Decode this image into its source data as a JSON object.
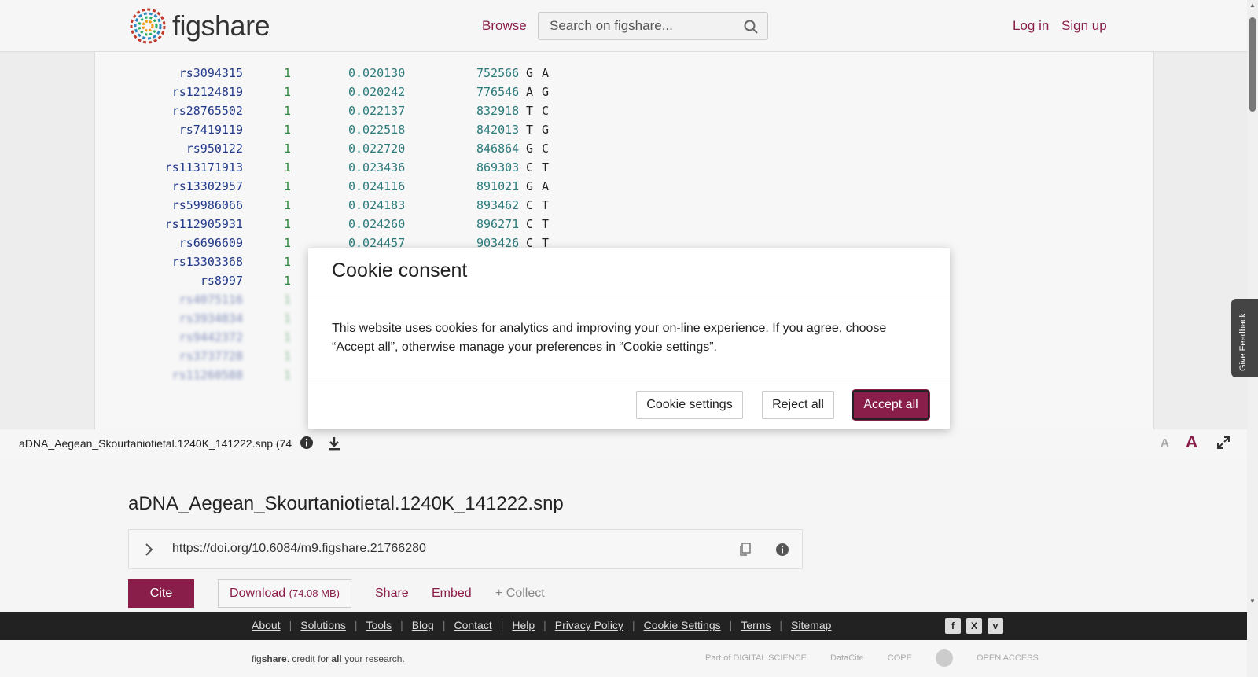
{
  "header": {
    "logo_text": "figshare",
    "browse": "Browse",
    "search_placeholder": "Search on figshare...",
    "login": "Log in",
    "signup": "Sign up"
  },
  "viewer": {
    "rows": [
      {
        "id": "rs3094315",
        "chr": "1",
        "gen": "0.020130",
        "pos": "752566",
        "a1": "G",
        "a2": "A"
      },
      {
        "id": "rs12124819",
        "chr": "1",
        "gen": "0.020242",
        "pos": "776546",
        "a1": "A",
        "a2": "G"
      },
      {
        "id": "rs28765502",
        "chr": "1",
        "gen": "0.022137",
        "pos": "832918",
        "a1": "T",
        "a2": "C"
      },
      {
        "id": "rs7419119",
        "chr": "1",
        "gen": "0.022518",
        "pos": "842013",
        "a1": "T",
        "a2": "G"
      },
      {
        "id": "rs950122",
        "chr": "1",
        "gen": "0.022720",
        "pos": "846864",
        "a1": "G",
        "a2": "C"
      },
      {
        "id": "rs113171913",
        "chr": "1",
        "gen": "0.023436",
        "pos": "869303",
        "a1": "C",
        "a2": "T"
      },
      {
        "id": "rs13302957",
        "chr": "1",
        "gen": "0.024116",
        "pos": "891021",
        "a1": "G",
        "a2": "A"
      },
      {
        "id": "rs59986066",
        "chr": "1",
        "gen": "0.024183",
        "pos": "893462",
        "a1": "C",
        "a2": "T"
      },
      {
        "id": "rs112905931",
        "chr": "1",
        "gen": "0.024260",
        "pos": "896271",
        "a1": "C",
        "a2": "T"
      },
      {
        "id": "rs6696609",
        "chr": "1",
        "gen": "0.024457",
        "pos": "903426",
        "a1": "C",
        "a2": "T"
      },
      {
        "id": "rs13303368",
        "chr": "1",
        "gen": "",
        "pos": "",
        "a1": "",
        "a2": ""
      },
      {
        "id": "rs8997",
        "chr": "1",
        "gen": "",
        "pos": "",
        "a1": "",
        "a2": ""
      }
    ],
    "file_label": "aDNA_Aegean_Skourtaniotietal.1240K_141222.snp (74",
    "font_small": "A",
    "font_large": "A"
  },
  "item": {
    "title": "aDNA_Aegean_Skourtaniotietal.1240K_141222.snp",
    "doi": "https://doi.org/10.6084/m9.figshare.21766280",
    "cite": "Cite",
    "download": "Download",
    "download_size": "(74.08 MB)",
    "share": "Share",
    "embed": "Embed",
    "collect": "+ Collect"
  },
  "footer": {
    "links": [
      "About",
      "Solutions",
      "Tools",
      "Blog",
      "Contact",
      "Help",
      "Privacy Policy",
      "Cookie Settings",
      "Terms",
      "Sitemap"
    ],
    "tagline_fig": "fig",
    "tagline_share": "share",
    "tagline_mid": ". credit for ",
    "tagline_all": "all",
    "tagline_end": " your research.",
    "partners": [
      "Part of DIGITAL SCIENCE",
      "DataCite",
      "COPE",
      "",
      "OPEN ACCESS"
    ]
  },
  "feedback": "Give Feedback",
  "modal": {
    "title": "Cookie consent",
    "body": "This website uses cookies for analytics and improving your on-line experience. If you agree, choose “Accept all”, otherwise manage your preferences in “Cookie settings”.",
    "settings": "Cookie settings",
    "reject": "Reject all",
    "accept": "Accept all"
  },
  "colors": {
    "accent": "#8a1e4a",
    "footer_bg": "#222222"
  }
}
